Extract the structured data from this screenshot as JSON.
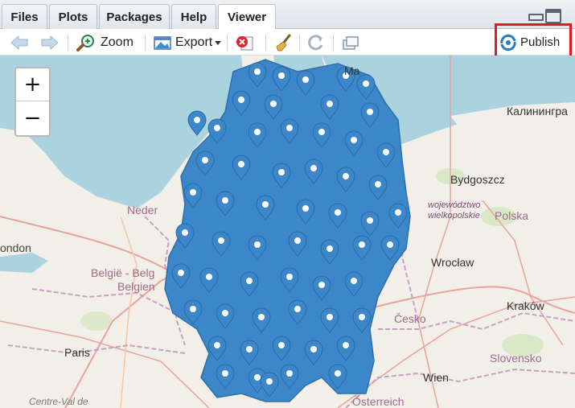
{
  "tabs": [
    {
      "label": "Files"
    },
    {
      "label": "Plots"
    },
    {
      "label": "Packages"
    },
    {
      "label": "Help"
    },
    {
      "label": "Viewer"
    }
  ],
  "active_tab": "Viewer",
  "toolbar": {
    "zoom_label": "Zoom",
    "export_label": "Export",
    "publish_label": "Publish"
  },
  "map": {
    "zoom_in": "+",
    "zoom_out": "−",
    "place_labels": {
      "kaliningrad": "Калинингра",
      "bydgoszcz": "Bydgoszcz",
      "wojewodztwo": "województwo",
      "wielkopolskie": "wielkopolskie",
      "polska": "Polska",
      "nederland": "Neder",
      "london": "ondon",
      "belgie": "België - Belg",
      "belgien": "Belgien",
      "wroclaw": "Wrocław",
      "krakow": "Kraków",
      "cesko": "Česko",
      "paris": "Paris",
      "slovensko": "Slovensko",
      "wien": "Wien",
      "osterreich": "Österreich",
      "centre": "Centre-Val de",
      "ma": "Ma"
    },
    "colors": {
      "sea": "#aad3df",
      "land": "#f2efe9",
      "marker": "#3b87c9",
      "border": "#c69fc4"
    }
  }
}
